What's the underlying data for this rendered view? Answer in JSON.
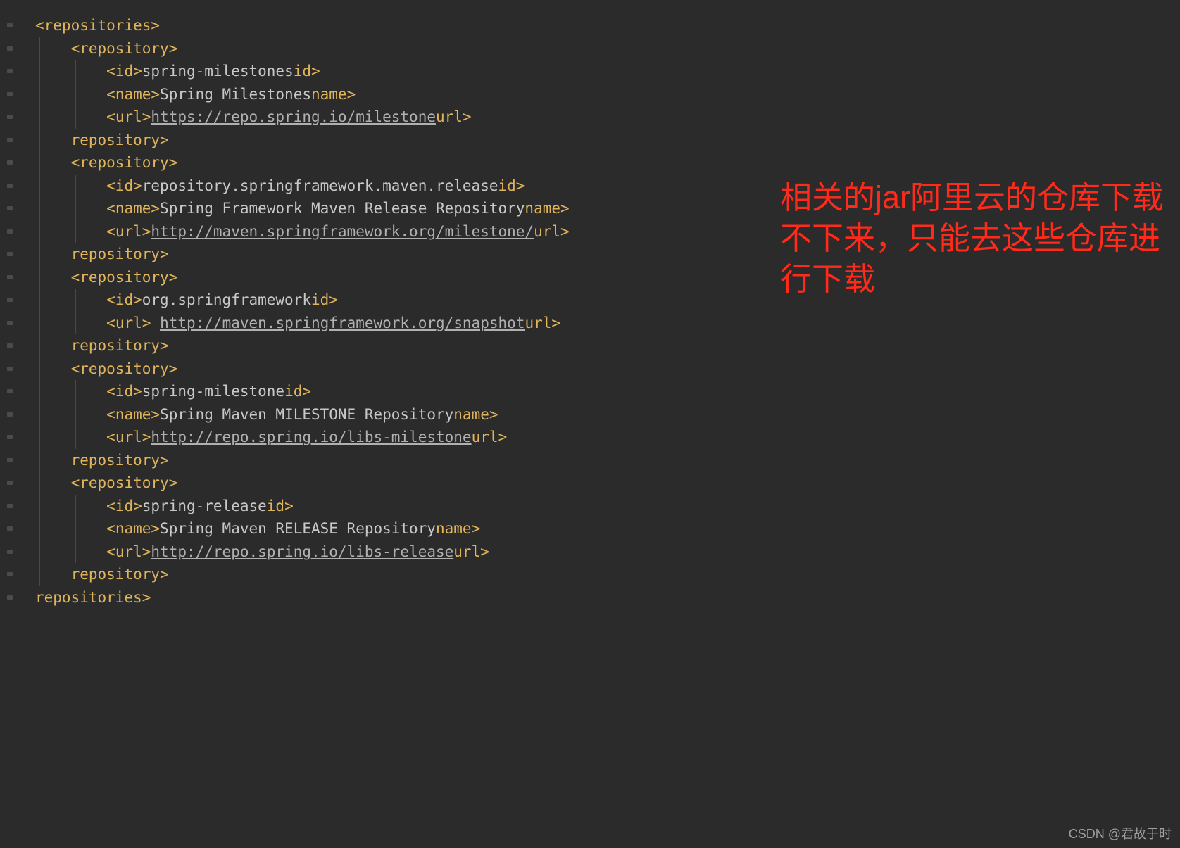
{
  "indentCharWidth": 12.6,
  "lineHeight": 32.5,
  "annotation": "相关的jar阿里云的仓库下载不下来，只能去这些仓库进行下载",
  "watermark": "CSDN @君故于时",
  "lines": [
    {
      "indent": 0,
      "open": "<",
      "tag": "repositories",
      "close": ">"
    },
    {
      "indent": 1,
      "open": "<",
      "tag": "repository",
      "close": ">"
    },
    {
      "indent": 2,
      "open": "<",
      "tag": "id",
      "close": ">",
      "text": "spring-milestones",
      "endOpen": "</",
      "endTag": "id",
      "endClose": ">"
    },
    {
      "indent": 2,
      "open": "<",
      "tag": "name",
      "close": ">",
      "text": "Spring Milestones",
      "endOpen": "</",
      "endTag": "name",
      "endClose": ">"
    },
    {
      "indent": 2,
      "open": "<",
      "tag": "url",
      "close": ">",
      "url": "https://repo.spring.io/milestone",
      "endOpen": "</",
      "endTag": "url",
      "endClose": ">"
    },
    {
      "indent": 1,
      "open": "</",
      "tag": "repository",
      "close": ">"
    },
    {
      "indent": 1,
      "open": "<",
      "tag": "repository",
      "close": ">"
    },
    {
      "indent": 2,
      "open": "<",
      "tag": "id",
      "close": ">",
      "text": "repository.springframework.maven.release",
      "endOpen": "</",
      "endTag": "id",
      "endClose": ">"
    },
    {
      "indent": 2,
      "open": "<",
      "tag": "name",
      "close": ">",
      "text": "Spring Framework Maven Release Repository",
      "endOpen": "</",
      "endTag": "name",
      "endClose": ">"
    },
    {
      "indent": 2,
      "open": "<",
      "tag": "url",
      "close": ">",
      "url": "http://maven.springframework.org/milestone/",
      "endOpen": "</",
      "endTag": "url",
      "endClose": ">"
    },
    {
      "indent": 1,
      "open": "</",
      "tag": "repository",
      "close": ">"
    },
    {
      "indent": 1,
      "open": "<",
      "tag": "repository",
      "close": ">"
    },
    {
      "indent": 2,
      "open": "<",
      "tag": "id",
      "close": ">",
      "text": "org.springframework",
      "endOpen": "</",
      "endTag": "id",
      "endClose": ">"
    },
    {
      "indent": 2,
      "open": "<",
      "tag": "url",
      "close": ">",
      "pretext": " ",
      "url": "http://maven.springframework.org/snapshot",
      "endOpen": "</",
      "endTag": "url",
      "endClose": ">"
    },
    {
      "indent": 1,
      "open": "</",
      "tag": "repository",
      "close": ">"
    },
    {
      "indent": 1,
      "open": "<",
      "tag": "repository",
      "close": ">"
    },
    {
      "indent": 2,
      "open": "<",
      "tag": "id",
      "close": ">",
      "text": "spring-milestone",
      "endOpen": "</",
      "endTag": "id",
      "endClose": ">"
    },
    {
      "indent": 2,
      "open": "<",
      "tag": "name",
      "close": ">",
      "text": "Spring Maven MILESTONE Repository",
      "endOpen": "</",
      "endTag": "name",
      "endClose": ">"
    },
    {
      "indent": 2,
      "open": "<",
      "tag": "url",
      "close": ">",
      "url": "http://repo.spring.io/libs-milestone",
      "endOpen": "</",
      "endTag": "url",
      "endClose": ">"
    },
    {
      "indent": 1,
      "open": "</",
      "tag": "repository",
      "close": ">"
    },
    {
      "indent": 1,
      "open": "<",
      "tag": "repository",
      "close": ">"
    },
    {
      "indent": 2,
      "open": "<",
      "tag": "id",
      "close": ">",
      "text": "spring-release",
      "endOpen": "</",
      "endTag": "id",
      "endClose": ">"
    },
    {
      "indent": 2,
      "open": "<",
      "tag": "name",
      "close": ">",
      "text": "Spring Maven RELEASE Repository",
      "endOpen": "</",
      "endTag": "name",
      "endClose": ">"
    },
    {
      "indent": 2,
      "open": "<",
      "tag": "url",
      "close": ">",
      "url": "http://repo.spring.io/libs-release",
      "endOpen": "</",
      "endTag": "url",
      "endClose": ">"
    },
    {
      "indent": 1,
      "open": "</",
      "tag": "repository",
      "close": ">"
    },
    {
      "indent": 0,
      "open": "</",
      "tag": "repositories",
      "close": ">"
    }
  ],
  "guideStyle": {
    "color": "#484848",
    "width": 1
  }
}
